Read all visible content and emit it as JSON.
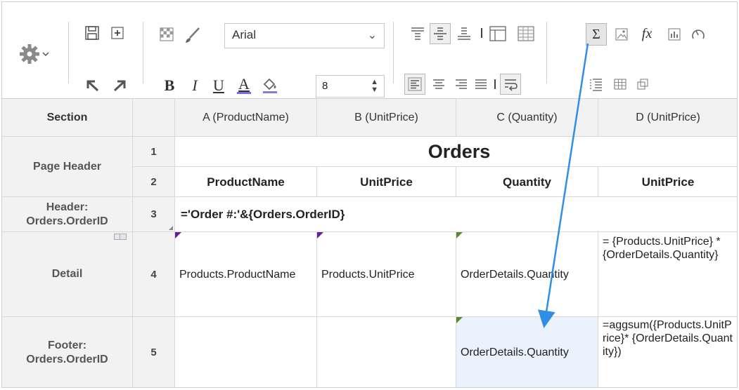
{
  "toolbar": {
    "font_name": "Arial",
    "font_size": "8",
    "bold_label": "B",
    "italic_label": "I",
    "underline_label": "U",
    "font_color_label": "A",
    "fx_label": "fx",
    "sigma_label": "Σ",
    "font_color": "#7b68ee",
    "fill_color": "#8c7bd6"
  },
  "grid": {
    "columns": [
      "Section",
      "",
      "A (ProductName)",
      "B (UnitPrice)",
      "C (Quantity)",
      "D (UnitPrice)"
    ],
    "sections": {
      "page_header": "Page Header",
      "header": "Header: Orders.OrderID",
      "detail": "Detail",
      "footer": "Footer: Orders.OrderID"
    },
    "rows": [
      "1",
      "2",
      "3",
      "4",
      "5"
    ],
    "title": "Orders",
    "header_cells": [
      "ProductName",
      "UnitPrice",
      "Quantity",
      "UnitPrice"
    ],
    "group_expr": "='Order #:'&{Orders.OrderID}",
    "detail_cells": [
      "Products.ProductName",
      "Products.UnitPrice",
      "OrderDetails.Quantity",
      "= {Products.UnitPrice} * {OrderDetails.Quantity}"
    ],
    "footer_cells": [
      "",
      "",
      "OrderDetails.Quantity",
      "=aggsum({Products.UnitPrice}* {OrderDetails.Quantity})"
    ]
  },
  "colors": {
    "selected_cell": "#eaf2fb",
    "arrow": "#2f8fe6",
    "marker_purple": "#6a1b9a",
    "marker_green": "#558b2f"
  }
}
